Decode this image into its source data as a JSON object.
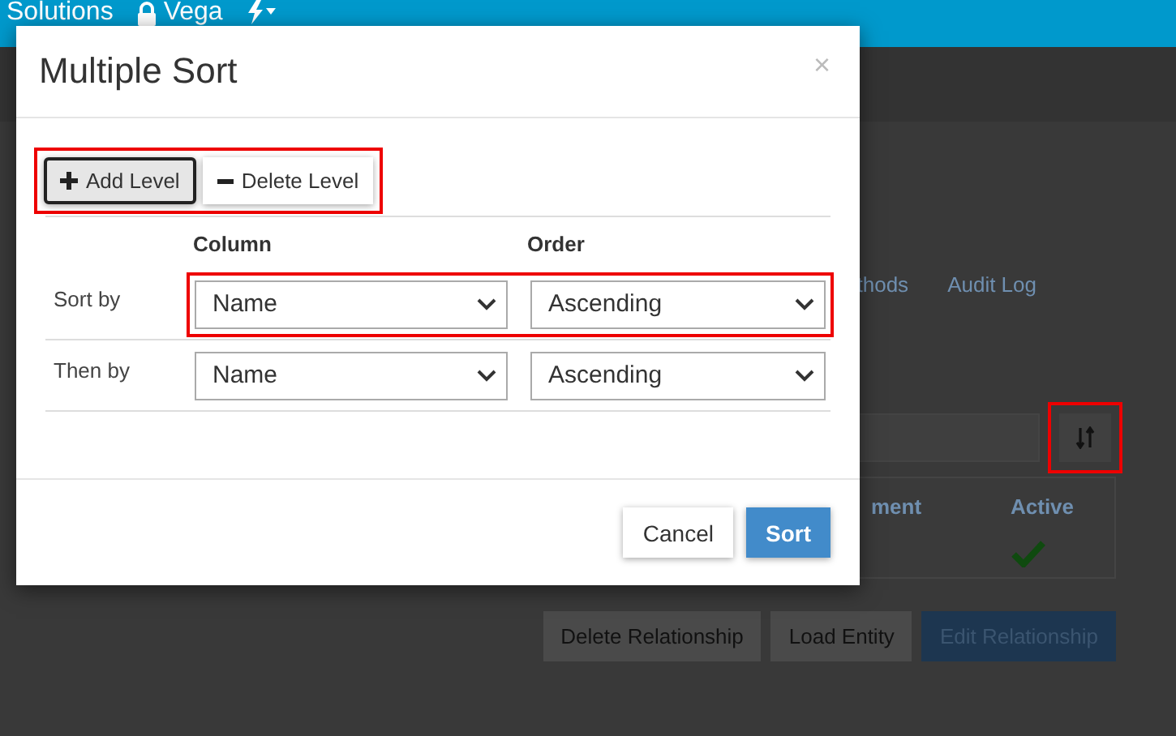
{
  "top_bar": {
    "title": "Solutions",
    "user": "Vega"
  },
  "page": {
    "tabs": [
      {
        "label": "thods"
      },
      {
        "label": "Audit Log"
      }
    ],
    "sort_button": {
      "highlighted": true
    },
    "table": {
      "columns": [
        "ment",
        "Active"
      ],
      "rows": [
        {
          "active": true
        }
      ]
    },
    "actions": [
      {
        "label": "Delete Relationship",
        "kind": "default"
      },
      {
        "label": "Load Entity",
        "kind": "default"
      },
      {
        "label": "Edit Relationship",
        "kind": "primary"
      }
    ]
  },
  "dialog": {
    "title": "Multiple Sort",
    "close": "×",
    "toolbar_highlighted": true,
    "toolbar": [
      {
        "label": "Add Level",
        "kind": "add",
        "focused": true
      },
      {
        "label": "Delete Level",
        "kind": "delete",
        "focused": false
      }
    ],
    "columns": [
      "Column",
      "Order"
    ],
    "levels": [
      {
        "label": "Sort by",
        "column": "Name",
        "order": "Ascending",
        "highlighted": true
      },
      {
        "label": "Then by",
        "column": "Name",
        "order": "Ascending",
        "highlighted": false
      }
    ],
    "buttons": [
      {
        "label": "Cancel",
        "kind": "default"
      },
      {
        "label": "Sort",
        "kind": "primary"
      }
    ]
  }
}
